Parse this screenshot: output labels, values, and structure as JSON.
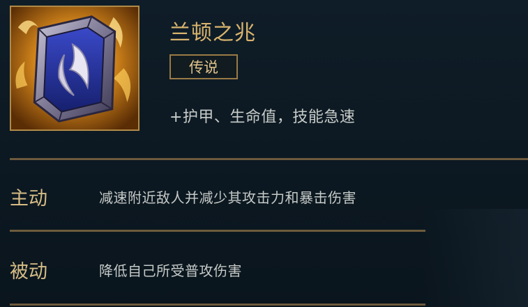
{
  "item": {
    "name": "兰顿之兆",
    "rarity": "传说",
    "stats": "+护甲、生命值，技能急速",
    "icon": "randuins-omen-shield-icon"
  },
  "rows": [
    {
      "label": "主动",
      "description": "减速附近敌人并减少其攻击力和暴击伤害"
    },
    {
      "label": "被动",
      "description": "降低自己所受普攻伤害"
    }
  ],
  "colors": {
    "background": "#0f1d28",
    "gold": "#d9b46e",
    "divider": "#6d5a3c",
    "text": "#c6cac8"
  }
}
